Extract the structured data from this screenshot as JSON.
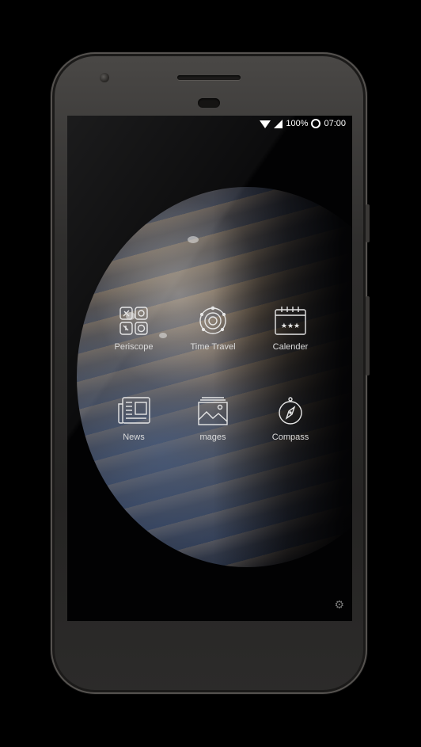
{
  "status_bar": {
    "battery": "100%",
    "time": "07:00"
  },
  "apps": [
    {
      "label": "Periscope",
      "icon": "periscope-icon"
    },
    {
      "label": "Time Travel",
      "icon": "time-travel-icon"
    },
    {
      "label": "Calender",
      "icon": "calendar-icon"
    },
    {
      "label": "News",
      "icon": "newspaper-icon"
    },
    {
      "label": "mages",
      "icon": "images-icon"
    },
    {
      "label": "Compass",
      "icon": "compass-icon"
    }
  ],
  "settings_icon": "gear-icon"
}
